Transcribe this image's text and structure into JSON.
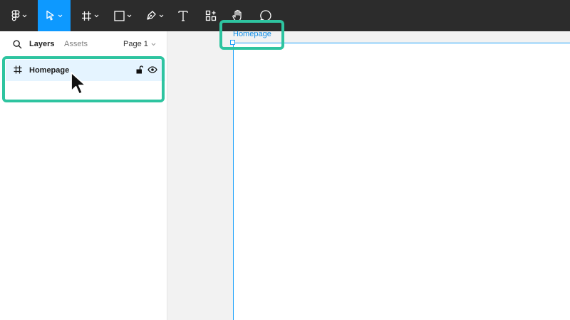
{
  "toolbar": {
    "tools": [
      {
        "name": "main-menu",
        "icon": "figma-logo-icon"
      },
      {
        "name": "move",
        "icon": "cursor-arrow-icon",
        "active": true
      },
      {
        "name": "frame",
        "icon": "frame-hash-icon"
      },
      {
        "name": "shape",
        "icon": "rectangle-icon"
      },
      {
        "name": "pen",
        "icon": "pen-icon"
      },
      {
        "name": "text",
        "icon": "text-icon"
      },
      {
        "name": "resources",
        "icon": "components-icon"
      },
      {
        "name": "hand",
        "icon": "hand-icon"
      },
      {
        "name": "comment",
        "icon": "comment-icon"
      }
    ],
    "accent_color": "#0d99ff"
  },
  "left_panel": {
    "tabs": {
      "layers": "Layers",
      "assets": "Assets"
    },
    "page_selector": "Page 1",
    "layers": [
      {
        "name": "Homepage",
        "icon": "frame-hash-icon",
        "selected": true
      }
    ]
  },
  "canvas": {
    "frame_label": "Homepage",
    "selection_color": "#18a0fb"
  },
  "highlight_color": "#2ec4a0"
}
